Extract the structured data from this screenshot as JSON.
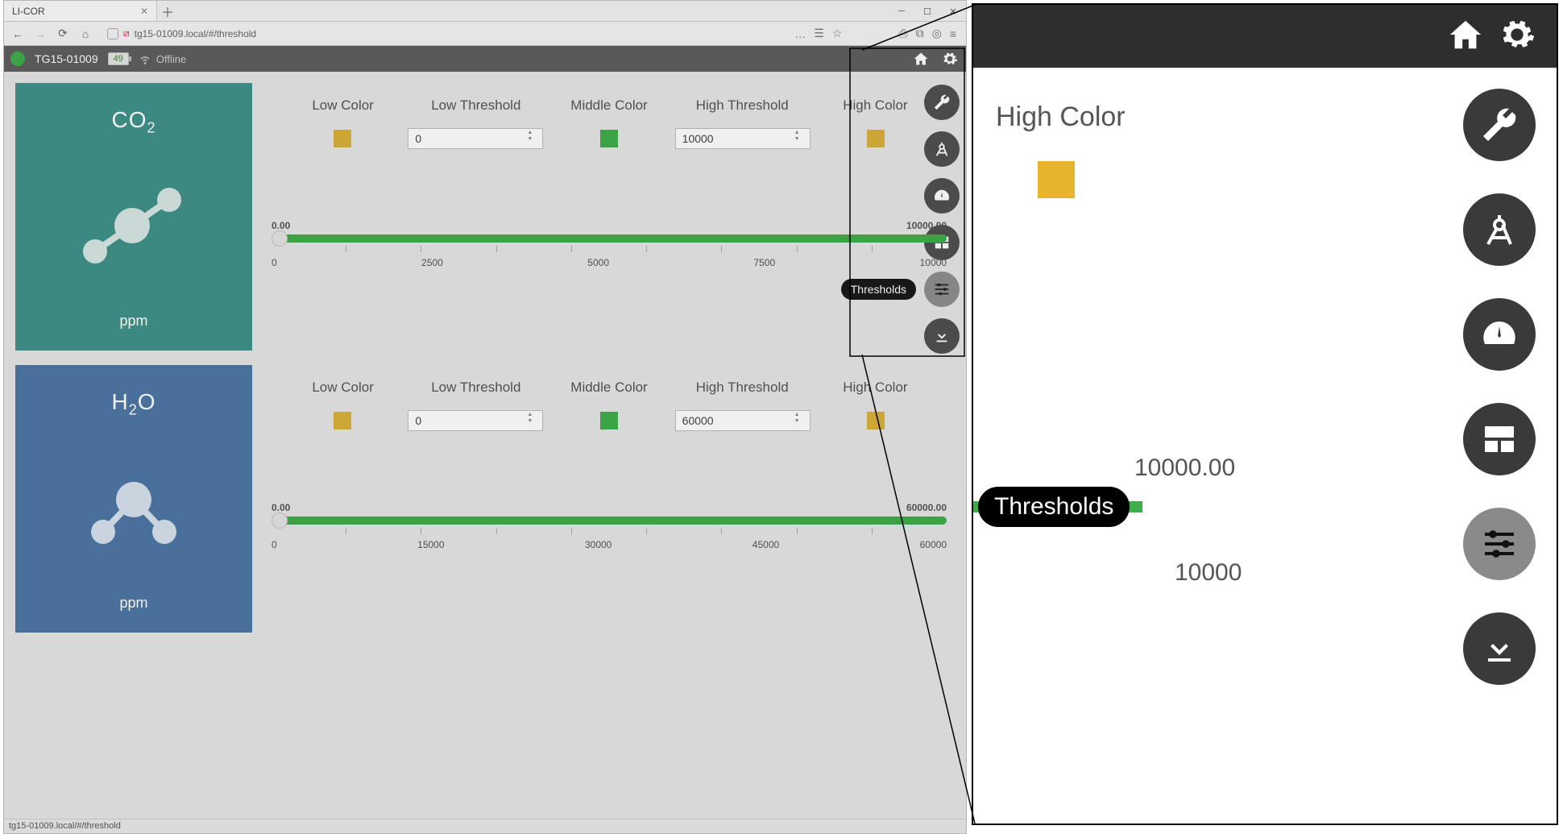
{
  "browser": {
    "tab_title": "LI-COR",
    "url": "tg15-01009.local/#/threshold",
    "status_bar": "tg15-01009.local/#/threshold",
    "toolbar_ellipsis": "…"
  },
  "header": {
    "device": "TG15-01009",
    "battery": "49",
    "conn_status": "Offline"
  },
  "side_tools": {
    "tooltip": "Thresholds"
  },
  "labels": {
    "low_color": "Low Color",
    "low_threshold": "Low Threshold",
    "middle_color": "Middle Color",
    "high_threshold": "High Threshold",
    "high_color": "High Color"
  },
  "co2": {
    "title_pre": "CO",
    "title_sub": "2",
    "unit": "ppm",
    "low_threshold": "0",
    "high_threshold": "10000",
    "range_min": "0.00",
    "range_max": "10000.00",
    "ticks": [
      "0",
      "2500",
      "5000",
      "7500",
      "10000"
    ]
  },
  "h2o": {
    "title_pre": "H",
    "title_sub": "2",
    "title_post": "O",
    "unit": "ppm",
    "low_threshold": "0",
    "high_threshold": "60000",
    "range_min": "0.00",
    "range_max": "60000.00",
    "ticks": [
      "0",
      "15000",
      "30000",
      "45000",
      "60000"
    ]
  },
  "zoom": {
    "high_color_label": "High Color",
    "tooltip": "Thresholds",
    "max1": "10000.00",
    "max2": "10000"
  }
}
